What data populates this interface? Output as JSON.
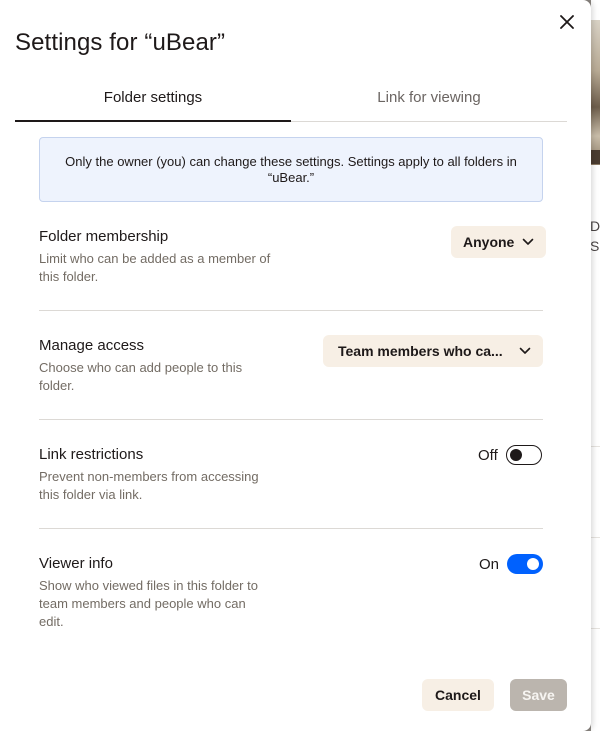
{
  "dialog": {
    "title": "Settings for “uBear”",
    "close_icon": "close-icon"
  },
  "tabs": [
    {
      "label": "Folder settings",
      "active": true
    },
    {
      "label": "Link for viewing",
      "active": false
    }
  ],
  "info_text": "Only the owner (you) can change these settings. Settings apply to all folders in “uBear.”",
  "settings": {
    "folder_membership": {
      "title": "Folder membership",
      "description": "Limit who can be added as a member of this folder.",
      "value": "Anyone"
    },
    "manage_access": {
      "title": "Manage access",
      "description": "Choose who can add people to this folder.",
      "value": "Team members who ca..."
    },
    "link_restrictions": {
      "title": "Link restrictions",
      "description": "Prevent non-members from accessing this folder via link.",
      "state_label": "Off",
      "enabled": false
    },
    "viewer_info": {
      "title": "Viewer info",
      "description": "Show who viewed files in this folder to team members and people who can edit.",
      "state_label": "On",
      "enabled": true
    }
  },
  "footer": {
    "cancel_label": "Cancel",
    "save_label": "Save"
  },
  "background": {
    "peek_chars": [
      "D",
      "S"
    ]
  },
  "colors": {
    "accent_blue": "#0061fe",
    "info_bg": "#eef3fd",
    "button_bg": "#f7efe5",
    "disabled_button": "#bbb5ae"
  }
}
